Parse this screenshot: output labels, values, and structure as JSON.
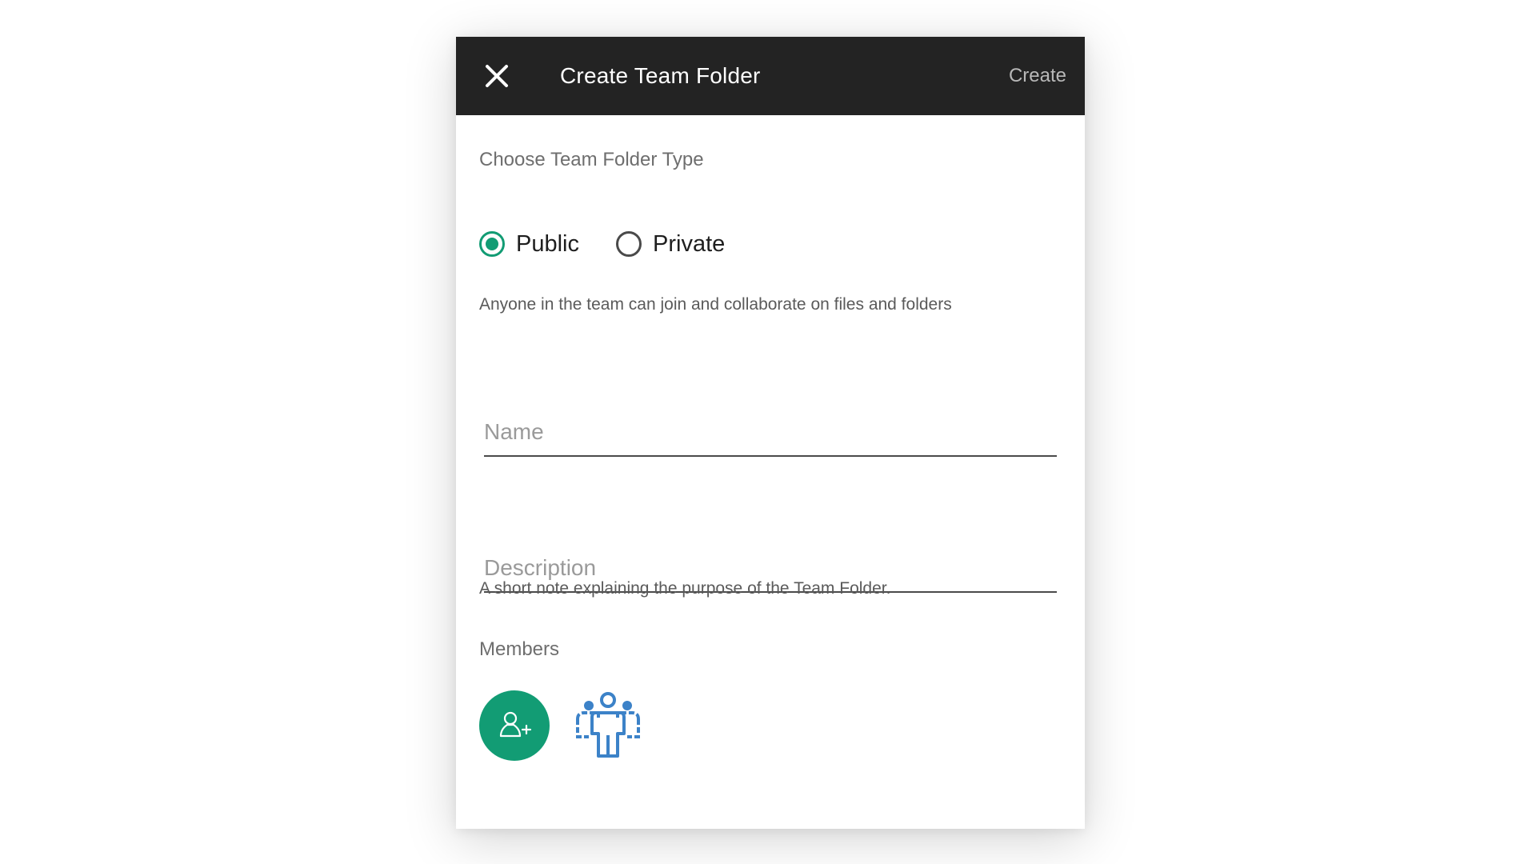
{
  "dialog": {
    "title": "Create Team Folder",
    "create_label": "Create",
    "close_icon": "close-icon"
  },
  "type_section": {
    "label": "Choose Team Folder Type",
    "options": [
      {
        "label": "Public",
        "selected": true
      },
      {
        "label": "Private",
        "selected": false
      }
    ],
    "description": "Anyone in the team can join and collaborate on files and folders"
  },
  "name_field": {
    "placeholder": "Name",
    "value": ""
  },
  "description_field": {
    "placeholder": "Description",
    "value": "",
    "helper": "A short note explaining the purpose of the Team Folder."
  },
  "members": {
    "label": "Members",
    "add_icon": "add-user-icon",
    "group_icon": "user-group-icon"
  },
  "colors": {
    "header_bg": "#232323",
    "accent": "#129c74",
    "group_icon": "#3c82c8",
    "create_text": "#b8b8b8"
  }
}
